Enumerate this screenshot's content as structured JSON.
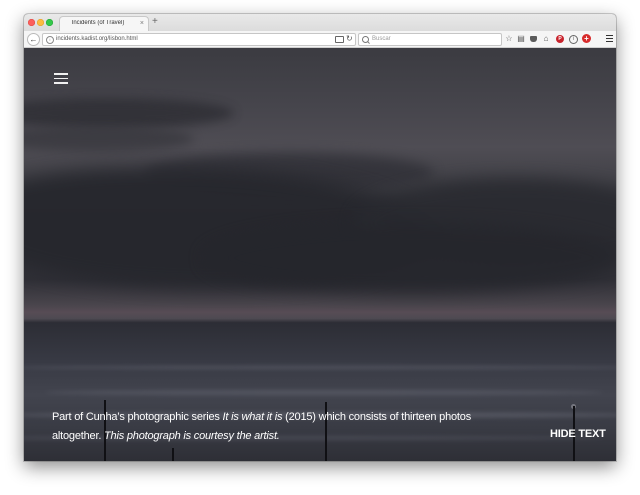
{
  "browser": {
    "tab": {
      "title": "Incidents (of Travel)",
      "close": "×"
    },
    "new_tab": "+",
    "back": "←",
    "url": "incidents.kadist.org/lisbon.html",
    "reload": "↻",
    "search_placeholder": "Buscar",
    "toolbar_icons": [
      "star-icon",
      "clipboard-icon",
      "pocket-icon",
      "home-icon",
      "pinterest-icon",
      "info-icon",
      "addon-plus-icon"
    ],
    "toolbar_glyphs": {
      "star": "☆",
      "clipboard": "▤",
      "home": "⌂",
      "pinterest": "P",
      "info": "i",
      "plus": "+"
    }
  },
  "page": {
    "menu_icon": "hamburger-icon",
    "caption": {
      "part1": "Part of Cunha’s photographic series ",
      "series_title": "It is what it is",
      "part2": " (2015) which consists of thirteen photos altogether. ",
      "credit": "This photograph is courtesy the artist."
    },
    "hide_text_label": "HIDE TEXT"
  },
  "colors": {
    "close_light": "#fc605c",
    "minimize_light": "#fdbc40",
    "zoom_light": "#34c84a",
    "sky": "#46454c",
    "caption_text": "#ffffff"
  }
}
